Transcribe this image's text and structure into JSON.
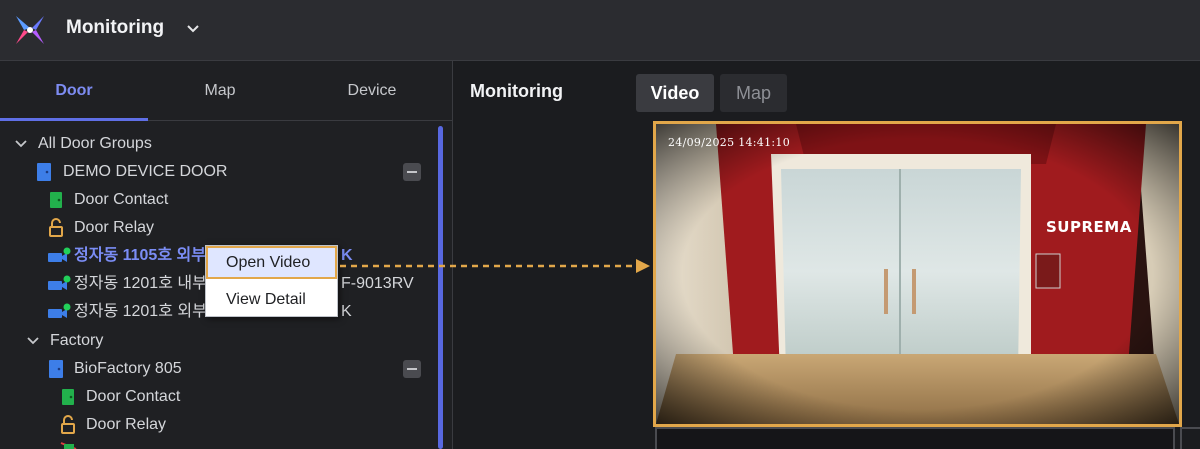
{
  "app": {
    "title": "Monitoring"
  },
  "left_tabs": [
    "Door",
    "Map",
    "Device"
  ],
  "tree": {
    "root": "All Door Groups",
    "group1": "DEMO DEVICE DOOR",
    "g1_contact": "Door Contact",
    "g1_relay": "Door Relay",
    "cam1_left": "정자동 1105호 외부",
    "cam1_right": "K",
    "cam2_left": "정자동 1201호 내부",
    "cam2_right": "F-9013RV",
    "cam3_left": "정자동 1201호 외부",
    "cam3_right": "K",
    "factory": "Factory",
    "group2": "BioFactory 805",
    "g2_contact": "Door Contact",
    "g2_relay": "Door Relay"
  },
  "context_menu": {
    "open_video": "Open Video",
    "view_detail": "View Detail"
  },
  "right": {
    "title": "Monitoring",
    "tab_video": "Video",
    "tab_map": "Map",
    "timestamp": "24/09/2025 14:41:10",
    "brand": "SUPREMA"
  },
  "colors": {
    "accent": "#5f6fe6",
    "highlight": "#e2a74a",
    "door_green": "#22b14c",
    "door_blue": "#3d7ee8"
  }
}
